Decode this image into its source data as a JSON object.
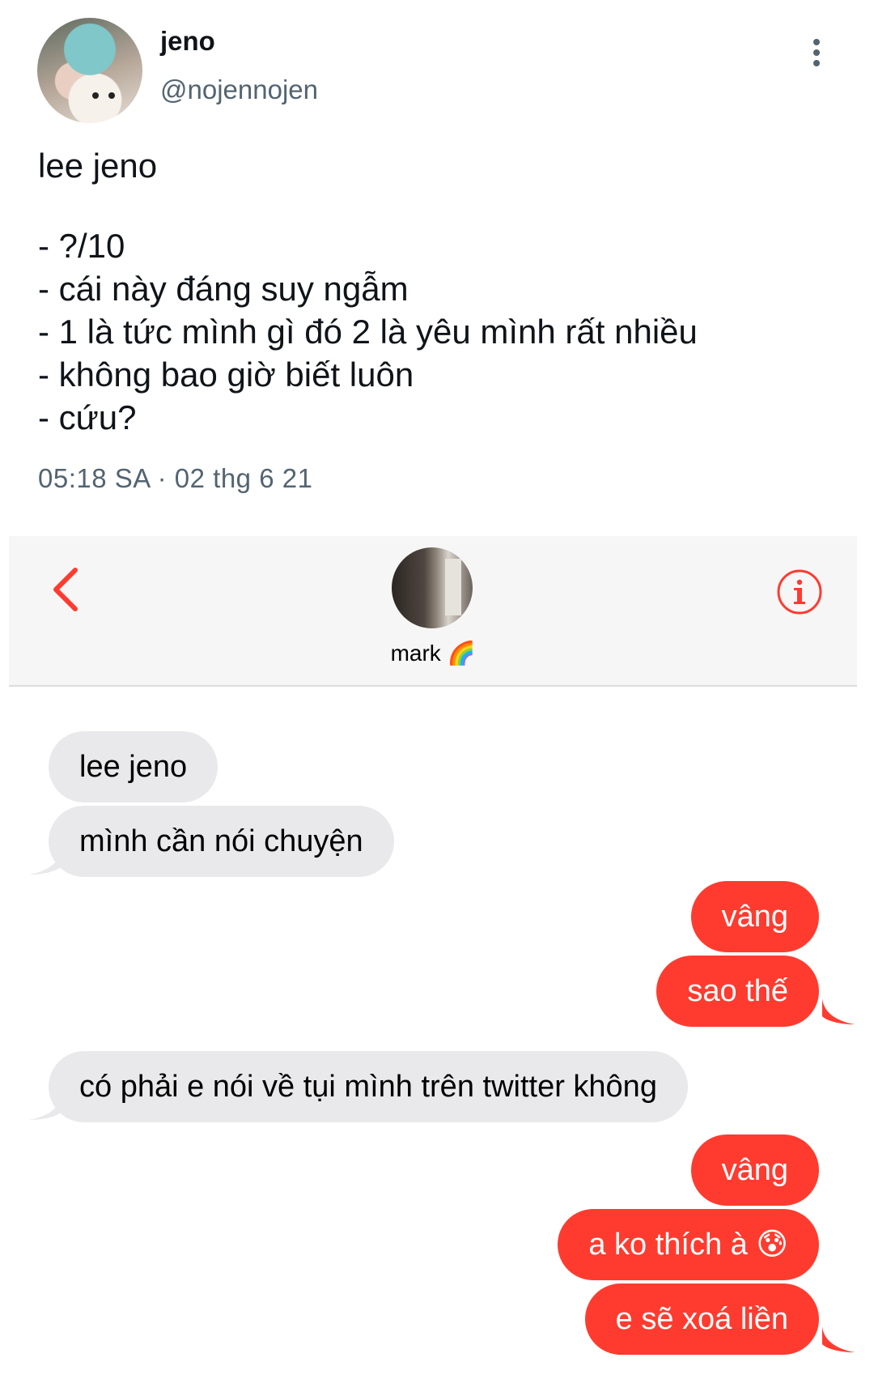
{
  "tweet": {
    "display_name": "jeno",
    "handle": "@nojennojen",
    "text_title": "lee jeno",
    "text_lines": [
      "- ?/10",
      "- cái này đáng suy ngẫm",
      "- 1 là tức mình gì đó 2 là yêu mình rất nhiều",
      "- không bao giờ biết luôn",
      "- cứu?"
    ],
    "timestamp": "05:18 SA · 02 thg 6 21"
  },
  "conversation": {
    "contact_name": "mark 🌈",
    "accent_color": "#ff3b2f",
    "messages": [
      {
        "from": "them",
        "text": "lee jeno"
      },
      {
        "from": "them",
        "text": "mình cần nói chuyện"
      },
      {
        "from": "me",
        "text": "vâng"
      },
      {
        "from": "me",
        "text": "sao thế"
      },
      {
        "from": "them",
        "text": "có phải e nói về tụi mình trên twitter không"
      },
      {
        "from": "me",
        "text": "vâng"
      },
      {
        "from": "me",
        "text": "a ko thích à 😰"
      },
      {
        "from": "me",
        "text": "e sẽ xoá liền"
      }
    ]
  },
  "icons": {
    "back": "chevron-left-icon",
    "info": "info-icon",
    "more": "more-vertical-icon"
  }
}
